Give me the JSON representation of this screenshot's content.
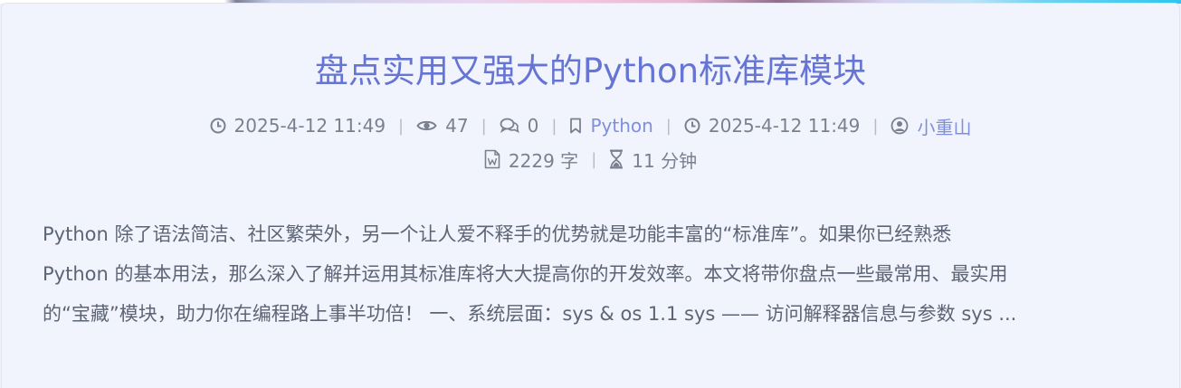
{
  "post": {
    "title": "盘点实用又强大的Python标准库模块",
    "meta": {
      "published": "2025-4-12 11:49",
      "views": "47",
      "comments": "0",
      "category": "Python",
      "updated": "2025-4-12 11:49",
      "author": "小重山",
      "word_count": "2229 字",
      "read_time": "11 分钟",
      "separator": "|"
    },
    "excerpt_lines": [
      "Python 除了语法简洁、社区繁荣外，另一个让人爱不释手的优势就是功能丰富的“标准库”。如果你已经熟悉",
      "Python 的基本用法，那么深入了解并运用其标准库将大大提高你的开发效率。本文将带你盘点一些最常用、最实用",
      "的“宝藏”模块，助力你在编程路上事半功倍！  一、系统层面：sys & os 1.1 sys —— 访问解释器信息与参数 sys ..."
    ]
  },
  "colors": {
    "title": "#6674d4",
    "link": "#7f8ee0",
    "meta_text": "#7a8090",
    "body_text": "#5d6475",
    "card_bg": "#f1f4fc"
  },
  "icons": {
    "published": "clock-icon",
    "views": "eye-icon",
    "comments": "comment-icon",
    "category": "bookmark-icon",
    "updated": "clock-icon",
    "author": "user-circle-icon",
    "word_count": "word-file-icon",
    "read_time": "hourglass-icon"
  }
}
